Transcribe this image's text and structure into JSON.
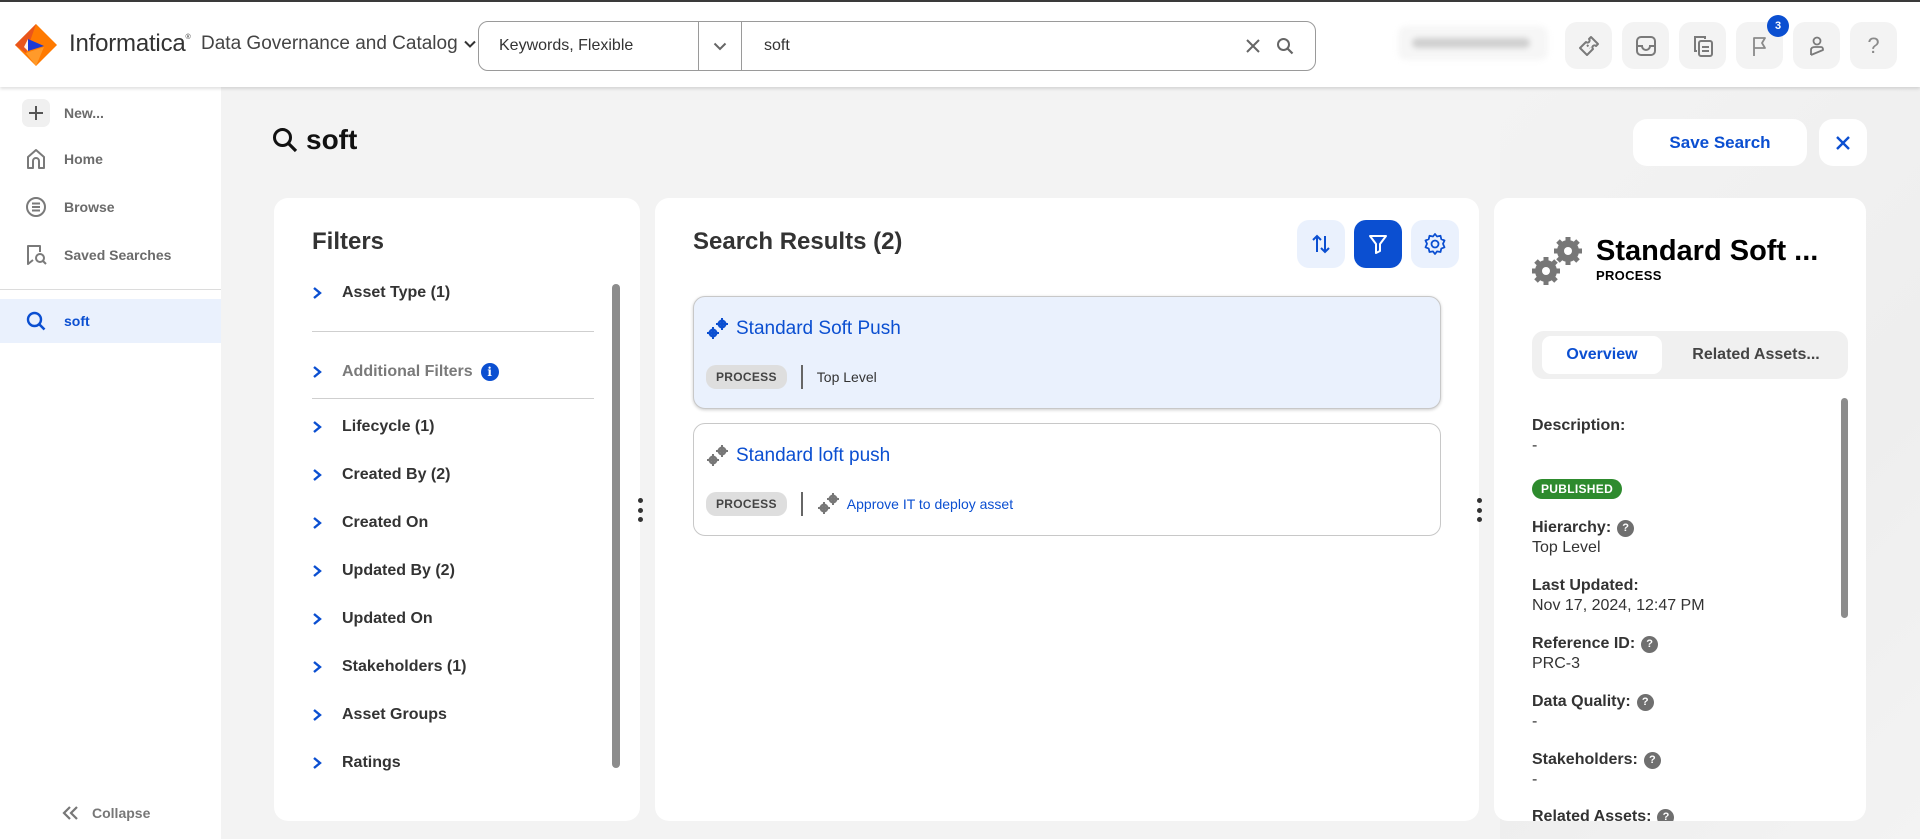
{
  "app": {
    "brand": "Informatica",
    "product": "Data Governance and Catalog"
  },
  "search": {
    "mode": "Keywords, Flexible",
    "query": "soft"
  },
  "topbar": {
    "notification_count": "3",
    "icons": [
      "ticket-icon",
      "inbox-icon",
      "documents-icon",
      "flag-icon",
      "user-icon",
      "help-icon"
    ]
  },
  "sidebar": {
    "items": [
      {
        "label": "New...",
        "icon": "plus-icon"
      },
      {
        "label": "Home",
        "icon": "home-icon"
      },
      {
        "label": "Browse",
        "icon": "browse-icon"
      },
      {
        "label": "Saved Searches",
        "icon": "saved-searches-icon"
      }
    ],
    "recent": [
      {
        "label": "soft",
        "icon": "search-icon",
        "active": true
      }
    ],
    "collapse_label": "Collapse"
  },
  "page": {
    "title": "soft",
    "save_search_label": "Save Search"
  },
  "filters": {
    "title": "Filters",
    "items": [
      {
        "label": "Asset Type (1)"
      },
      {
        "label": "Additional Filters"
      },
      {
        "label": "Lifecycle (1)"
      },
      {
        "label": "Created By (2)"
      },
      {
        "label": "Created On"
      },
      {
        "label": "Updated By (2)"
      },
      {
        "label": "Updated On"
      },
      {
        "label": "Stakeholders (1)"
      },
      {
        "label": "Asset Groups"
      },
      {
        "label": "Ratings"
      }
    ]
  },
  "results": {
    "title": "Search Results (2)",
    "items": [
      {
        "name": "Standard Soft Push",
        "type": "PROCESS",
        "context": "Top Level",
        "selected": true
      },
      {
        "name": "Standard loft push",
        "type": "PROCESS",
        "context": "Approve IT to deploy asset",
        "selected": false
      }
    ]
  },
  "detail": {
    "title": "Standard Soft ...",
    "type": "PROCESS",
    "tabs": [
      "Overview",
      "Related Assets..."
    ],
    "active_tab": "Overview",
    "status": "PUBLISHED",
    "fields": {
      "description": {
        "label": "Description:",
        "value": "-"
      },
      "hierarchy": {
        "label": "Hierarchy:",
        "value": "Top Level"
      },
      "last_updated": {
        "label": "Last Updated:",
        "value": "Nov 17, 2024, 12:47 PM"
      },
      "reference_id": {
        "label": "Reference ID:",
        "value": "PRC-3"
      },
      "data_quality": {
        "label": "Data Quality:",
        "value": "-"
      },
      "stakeholders": {
        "label": "Stakeholders:",
        "value": "-"
      },
      "related_assets": {
        "label": "Related Assets:"
      }
    }
  },
  "colors": {
    "accent": "#0b4fd1",
    "selected_bg": "#eaf1fd",
    "published": "#2e8b2e"
  }
}
